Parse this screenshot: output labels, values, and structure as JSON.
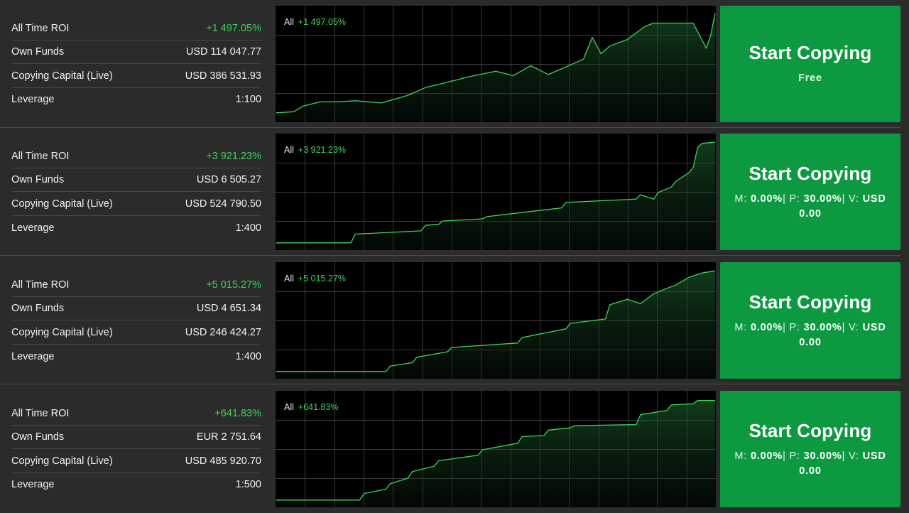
{
  "labels": {
    "roi": "All Time ROI",
    "own_funds": "Own Funds",
    "copying_capital": "Copying Capital (Live)",
    "leverage": "Leverage",
    "range": "All",
    "button_title": "Start Copying"
  },
  "colors": {
    "background": "#2b2b2b",
    "chart_background": "#000000",
    "positive_green": "#3ed45a",
    "button_green": "#0c9940"
  },
  "strategies": [
    {
      "roi": "+1 497.05%",
      "own_funds": "USD 114 047.77",
      "copying_capital": "USD 386 531.93",
      "leverage": "1:100",
      "button_sub": "Free",
      "fees": null
    },
    {
      "roi": "+3 921.23%",
      "own_funds": "USD 6 505.27",
      "copying_capital": "USD 524 790.50",
      "leverage": "1:400",
      "button_sub": null,
      "fees": {
        "m_label": "M:",
        "m": "0.00%",
        "p_label": "| P:",
        "p": "30.00%",
        "v_label": "| V:",
        "v": "USD 0.00"
      }
    },
    {
      "roi": "+5 015.27%",
      "own_funds": "USD 4 651.34",
      "copying_capital": "USD 246 424.27",
      "leverage": "1:400",
      "button_sub": null,
      "fees": {
        "m_label": "M:",
        "m": "0.00%",
        "p_label": "| P:",
        "p": "30.00%",
        "v_label": "| V:",
        "v": "USD 0.00"
      }
    },
    {
      "roi": "+641.83%",
      "own_funds": "EUR 2 751.64",
      "copying_capital": "USD 485 920.70",
      "leverage": "1:500",
      "button_sub": null,
      "fees": {
        "m_label": "M:",
        "m": "0.00%",
        "p_label": "| P:",
        "p": "30.00%",
        "v_label": "| V:",
        "v": "USD 0.00"
      }
    }
  ],
  "chart_data": [
    {
      "type": "area",
      "x_range": [
        0,
        1
      ],
      "ylim": [
        0,
        1
      ],
      "x": [
        0,
        0.04,
        0.06,
        0.1,
        0.14,
        0.18,
        0.24,
        0.3,
        0.34,
        0.38,
        0.44,
        0.5,
        0.54,
        0.58,
        0.62,
        0.66,
        0.7,
        0.72,
        0.74,
        0.76,
        0.8,
        0.84,
        0.86,
        0.87,
        0.89,
        0.92,
        0.95,
        0.98,
        0.99,
        1.0
      ],
      "values": [
        0.06,
        0.07,
        0.12,
        0.16,
        0.16,
        0.17,
        0.15,
        0.22,
        0.29,
        0.33,
        0.39,
        0.44,
        0.4,
        0.49,
        0.41,
        0.48,
        0.55,
        0.75,
        0.6,
        0.67,
        0.73,
        0.85,
        0.88,
        0.88,
        0.88,
        0.88,
        0.88,
        0.65,
        0.77,
        0.97
      ],
      "grid": true
    },
    {
      "type": "area",
      "x_range": [
        0,
        1
      ],
      "ylim": [
        0,
        1
      ],
      "x": [
        0,
        0.17,
        0.18,
        0.33,
        0.34,
        0.37,
        0.38,
        0.47,
        0.48,
        0.65,
        0.66,
        0.82,
        0.83,
        0.86,
        0.87,
        0.9,
        0.91,
        0.94,
        0.95,
        0.96,
        0.97,
        1.0
      ],
      "values": [
        0.04,
        0.04,
        0.12,
        0.15,
        0.2,
        0.21,
        0.24,
        0.26,
        0.28,
        0.36,
        0.41,
        0.44,
        0.48,
        0.44,
        0.5,
        0.55,
        0.6,
        0.68,
        0.73,
        0.91,
        0.95,
        0.96
      ],
      "grid": true
    },
    {
      "type": "area",
      "x_range": [
        0,
        1
      ],
      "ylim": [
        0,
        1
      ],
      "x": [
        0,
        0.25,
        0.26,
        0.31,
        0.32,
        0.39,
        0.4,
        0.55,
        0.56,
        0.66,
        0.67,
        0.75,
        0.76,
        0.8,
        0.83,
        0.86,
        0.89,
        0.91,
        0.94,
        0.97,
        1.0
      ],
      "values": [
        0.04,
        0.04,
        0.09,
        0.12,
        0.17,
        0.22,
        0.26,
        0.3,
        0.35,
        0.43,
        0.48,
        0.52,
        0.65,
        0.7,
        0.66,
        0.75,
        0.8,
        0.83,
        0.9,
        0.94,
        0.96
      ],
      "grid": true
    },
    {
      "type": "area",
      "x_range": [
        0,
        1
      ],
      "ylim": [
        0,
        1
      ],
      "x": [
        0,
        0.19,
        0.2,
        0.25,
        0.26,
        0.3,
        0.31,
        0.36,
        0.37,
        0.46,
        0.47,
        0.55,
        0.56,
        0.61,
        0.62,
        0.67,
        0.68,
        0.82,
        0.83,
        0.89,
        0.9,
        0.95,
        0.96,
        1.0
      ],
      "values": [
        0.04,
        0.04,
        0.1,
        0.14,
        0.19,
        0.24,
        0.3,
        0.35,
        0.4,
        0.45,
        0.5,
        0.56,
        0.62,
        0.63,
        0.68,
        0.7,
        0.72,
        0.73,
        0.82,
        0.86,
        0.91,
        0.92,
        0.95,
        0.95
      ],
      "grid": true
    }
  ]
}
